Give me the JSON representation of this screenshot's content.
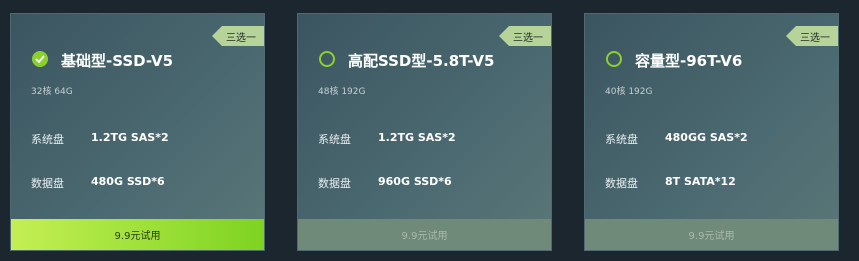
{
  "plans": [
    {
      "tag": "三选一",
      "title": "基础型-SSD-V5",
      "spec": "32核 64G",
      "system_disk_label": "系统盘",
      "system_disk_value": "1.2TG SAS*2",
      "data_disk_label": "数据盘",
      "data_disk_value": "480G SSD*6",
      "button_label": "9.9元试用",
      "selected": true
    },
    {
      "tag": "三选一",
      "title": "高配SSD型-5.8T-V5",
      "spec": "48核 192G",
      "system_disk_label": "系统盘",
      "system_disk_value": "1.2TG SAS*2",
      "data_disk_label": "数据盘",
      "data_disk_value": "960G SSD*6",
      "button_label": "9.9元试用",
      "selected": false
    },
    {
      "tag": "三选一",
      "title": "容量型-96T-V6",
      "spec": "40核 192G",
      "system_disk_label": "系统盘",
      "system_disk_value": "480GG SAS*2",
      "data_disk_label": "数据盘",
      "data_disk_value": "8T SATA*12",
      "button_label": "9.9元试用",
      "selected": false
    }
  ],
  "colors": {
    "accent": "#8bd12e",
    "tag_bg": "#b6d39a",
    "page_bg": "#1c262e"
  },
  "icons": {
    "selected": "check-icon"
  }
}
